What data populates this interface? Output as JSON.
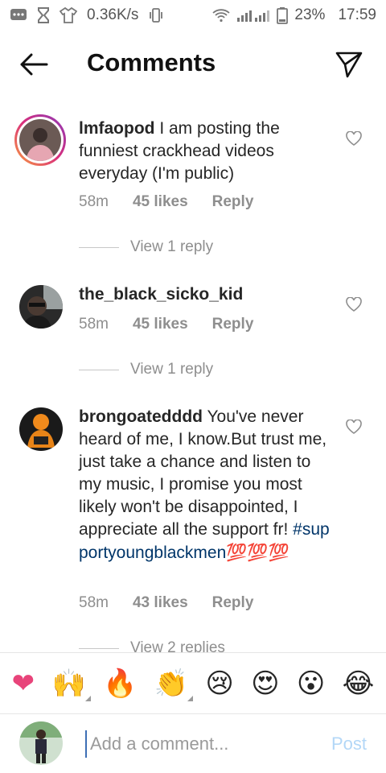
{
  "status_bar": {
    "network_speed": "0.36K/s",
    "battery": "23%",
    "time": "17:59"
  },
  "header": {
    "title": "Comments"
  },
  "comments": [
    {
      "username": "lmfaopod",
      "text": " I am posting the funniest crackhead videos everyday (I'm public)",
      "hashtag": "",
      "emoji_suffix": "",
      "time": "58m",
      "likes": "45 likes",
      "reply": "Reply",
      "view_replies": "View 1 reply"
    },
    {
      "username": "the_black_sicko_kid",
      "text": "",
      "hashtag": "",
      "emoji_suffix": "",
      "time": "58m",
      "likes": "45 likes",
      "reply": "Reply",
      "view_replies": "View 1 reply"
    },
    {
      "username": "brongoatedddd",
      "text": " You've never heard of me, I know.But trust me, just take a chance and listen to my music, I promise you most likely won't be disappointed, I appreciate all the support fr! ",
      "hashtag": "#supportyoungblackmen",
      "emoji_suffix": "💯💯💯",
      "time": "58m",
      "likes": "43 likes",
      "reply": "Reply",
      "view_replies": "View 2 replies"
    }
  ],
  "emoji_bar": [
    "❤",
    "🙌",
    "🔥",
    "👏",
    "😢",
    "😍",
    "😮",
    "😂"
  ],
  "composer": {
    "placeholder": "Add a comment...",
    "post_label": "Post"
  },
  "colors": {
    "hashtag": "#003569",
    "post_disabled": "#b3d7f7",
    "meta_gray": "#8e8e8e"
  }
}
